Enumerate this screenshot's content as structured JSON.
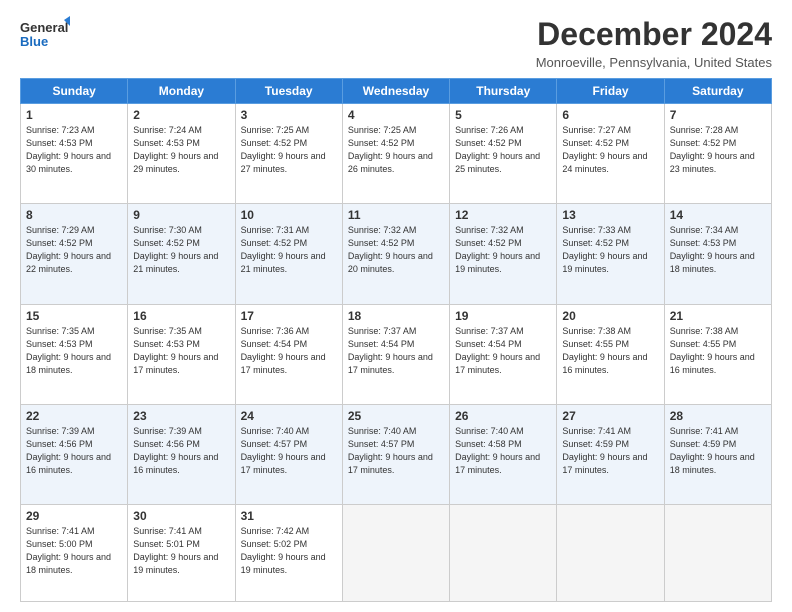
{
  "logo": {
    "line1": "General",
    "line2": "Blue"
  },
  "title": "December 2024",
  "subtitle": "Monroeville, Pennsylvania, United States",
  "days_header": [
    "Sunday",
    "Monday",
    "Tuesday",
    "Wednesday",
    "Thursday",
    "Friday",
    "Saturday"
  ],
  "weeks": [
    [
      {
        "num": "1",
        "sunrise": "7:23 AM",
        "sunset": "4:53 PM",
        "daylight": "9 hours and 30 minutes."
      },
      {
        "num": "2",
        "sunrise": "7:24 AM",
        "sunset": "4:53 PM",
        "daylight": "9 hours and 29 minutes."
      },
      {
        "num": "3",
        "sunrise": "7:25 AM",
        "sunset": "4:52 PM",
        "daylight": "9 hours and 27 minutes."
      },
      {
        "num": "4",
        "sunrise": "7:25 AM",
        "sunset": "4:52 PM",
        "daylight": "9 hours and 26 minutes."
      },
      {
        "num": "5",
        "sunrise": "7:26 AM",
        "sunset": "4:52 PM",
        "daylight": "9 hours and 25 minutes."
      },
      {
        "num": "6",
        "sunrise": "7:27 AM",
        "sunset": "4:52 PM",
        "daylight": "9 hours and 24 minutes."
      },
      {
        "num": "7",
        "sunrise": "7:28 AM",
        "sunset": "4:52 PM",
        "daylight": "9 hours and 23 minutes."
      }
    ],
    [
      {
        "num": "8",
        "sunrise": "7:29 AM",
        "sunset": "4:52 PM",
        "daylight": "9 hours and 22 minutes."
      },
      {
        "num": "9",
        "sunrise": "7:30 AM",
        "sunset": "4:52 PM",
        "daylight": "9 hours and 21 minutes."
      },
      {
        "num": "10",
        "sunrise": "7:31 AM",
        "sunset": "4:52 PM",
        "daylight": "9 hours and 21 minutes."
      },
      {
        "num": "11",
        "sunrise": "7:32 AM",
        "sunset": "4:52 PM",
        "daylight": "9 hours and 20 minutes."
      },
      {
        "num": "12",
        "sunrise": "7:32 AM",
        "sunset": "4:52 PM",
        "daylight": "9 hours and 19 minutes."
      },
      {
        "num": "13",
        "sunrise": "7:33 AM",
        "sunset": "4:52 PM",
        "daylight": "9 hours and 19 minutes."
      },
      {
        "num": "14",
        "sunrise": "7:34 AM",
        "sunset": "4:53 PM",
        "daylight": "9 hours and 18 minutes."
      }
    ],
    [
      {
        "num": "15",
        "sunrise": "7:35 AM",
        "sunset": "4:53 PM",
        "daylight": "9 hours and 18 minutes."
      },
      {
        "num": "16",
        "sunrise": "7:35 AM",
        "sunset": "4:53 PM",
        "daylight": "9 hours and 17 minutes."
      },
      {
        "num": "17",
        "sunrise": "7:36 AM",
        "sunset": "4:54 PM",
        "daylight": "9 hours and 17 minutes."
      },
      {
        "num": "18",
        "sunrise": "7:37 AM",
        "sunset": "4:54 PM",
        "daylight": "9 hours and 17 minutes."
      },
      {
        "num": "19",
        "sunrise": "7:37 AM",
        "sunset": "4:54 PM",
        "daylight": "9 hours and 17 minutes."
      },
      {
        "num": "20",
        "sunrise": "7:38 AM",
        "sunset": "4:55 PM",
        "daylight": "9 hours and 16 minutes."
      },
      {
        "num": "21",
        "sunrise": "7:38 AM",
        "sunset": "4:55 PM",
        "daylight": "9 hours and 16 minutes."
      }
    ],
    [
      {
        "num": "22",
        "sunrise": "7:39 AM",
        "sunset": "4:56 PM",
        "daylight": "9 hours and 16 minutes."
      },
      {
        "num": "23",
        "sunrise": "7:39 AM",
        "sunset": "4:56 PM",
        "daylight": "9 hours and 16 minutes."
      },
      {
        "num": "24",
        "sunrise": "7:40 AM",
        "sunset": "4:57 PM",
        "daylight": "9 hours and 17 minutes."
      },
      {
        "num": "25",
        "sunrise": "7:40 AM",
        "sunset": "4:57 PM",
        "daylight": "9 hours and 17 minutes."
      },
      {
        "num": "26",
        "sunrise": "7:40 AM",
        "sunset": "4:58 PM",
        "daylight": "9 hours and 17 minutes."
      },
      {
        "num": "27",
        "sunrise": "7:41 AM",
        "sunset": "4:59 PM",
        "daylight": "9 hours and 17 minutes."
      },
      {
        "num": "28",
        "sunrise": "7:41 AM",
        "sunset": "4:59 PM",
        "daylight": "9 hours and 18 minutes."
      }
    ],
    [
      {
        "num": "29",
        "sunrise": "7:41 AM",
        "sunset": "5:00 PM",
        "daylight": "9 hours and 18 minutes."
      },
      {
        "num": "30",
        "sunrise": "7:41 AM",
        "sunset": "5:01 PM",
        "daylight": "9 hours and 19 minutes."
      },
      {
        "num": "31",
        "sunrise": "7:42 AM",
        "sunset": "5:02 PM",
        "daylight": "9 hours and 19 minutes."
      },
      null,
      null,
      null,
      null
    ]
  ]
}
